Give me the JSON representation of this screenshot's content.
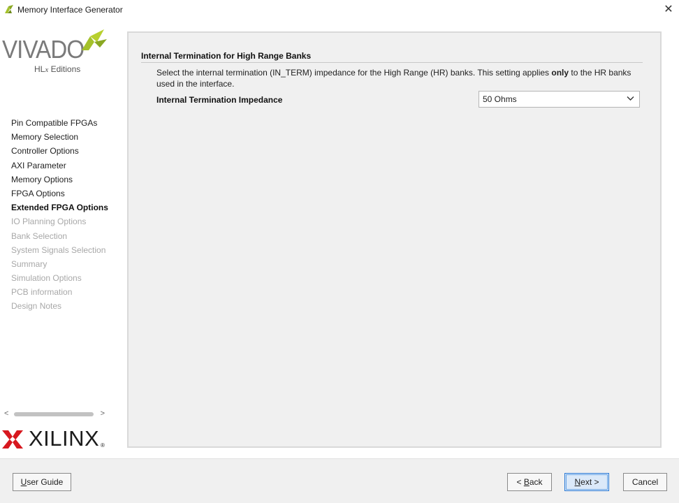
{
  "window": {
    "title": "Memory Interface Generator",
    "close_glyph": "✕"
  },
  "branding": {
    "vivado": "VIVADO",
    "vivado_sub_prefix": "HL",
    "vivado_sub_x": "x",
    "vivado_sub_suffix": " Editions",
    "xilinx": "XILINX",
    "xilinx_reg": "®",
    "accent_color": "#a4c12a"
  },
  "steps": [
    {
      "label": "Pin Compatible FPGAs",
      "state": "done"
    },
    {
      "label": "Memory Selection",
      "state": "done"
    },
    {
      "label": "Controller Options",
      "state": "done"
    },
    {
      "label": "AXI Parameter",
      "state": "done"
    },
    {
      "label": "Memory Options",
      "state": "done"
    },
    {
      "label": "FPGA Options",
      "state": "done"
    },
    {
      "label": "Extended FPGA Options",
      "state": "current"
    },
    {
      "label": "IO Planning Options",
      "state": "disabled"
    },
    {
      "label": "Bank Selection",
      "state": "disabled"
    },
    {
      "label": "System Signals Selection",
      "state": "disabled"
    },
    {
      "label": "Summary",
      "state": "disabled"
    },
    {
      "label": "Simulation Options",
      "state": "disabled"
    },
    {
      "label": "PCB information",
      "state": "disabled"
    },
    {
      "label": "Design Notes",
      "state": "disabled"
    }
  ],
  "scroll": {
    "left_arrow": "<",
    "right_arrow": ">"
  },
  "section": {
    "title": "Internal Termination for High Range Banks",
    "desc_part1": "Select the internal termination (IN_TERM) impedance for the High Range (HR) banks. This setting applies ",
    "desc_bold": "only",
    "desc_part2": " to the HR banks used in the interface.",
    "field_label": "Internal Termination Impedance",
    "field_value": "50 Ohms"
  },
  "buttons": {
    "user_guide_u": "U",
    "user_guide_rest": "ser Guide",
    "back_prefix": "< ",
    "back_u": "B",
    "back_rest": "ack",
    "next_u": "N",
    "next_rest": "ext >",
    "cancel": "Cancel"
  }
}
